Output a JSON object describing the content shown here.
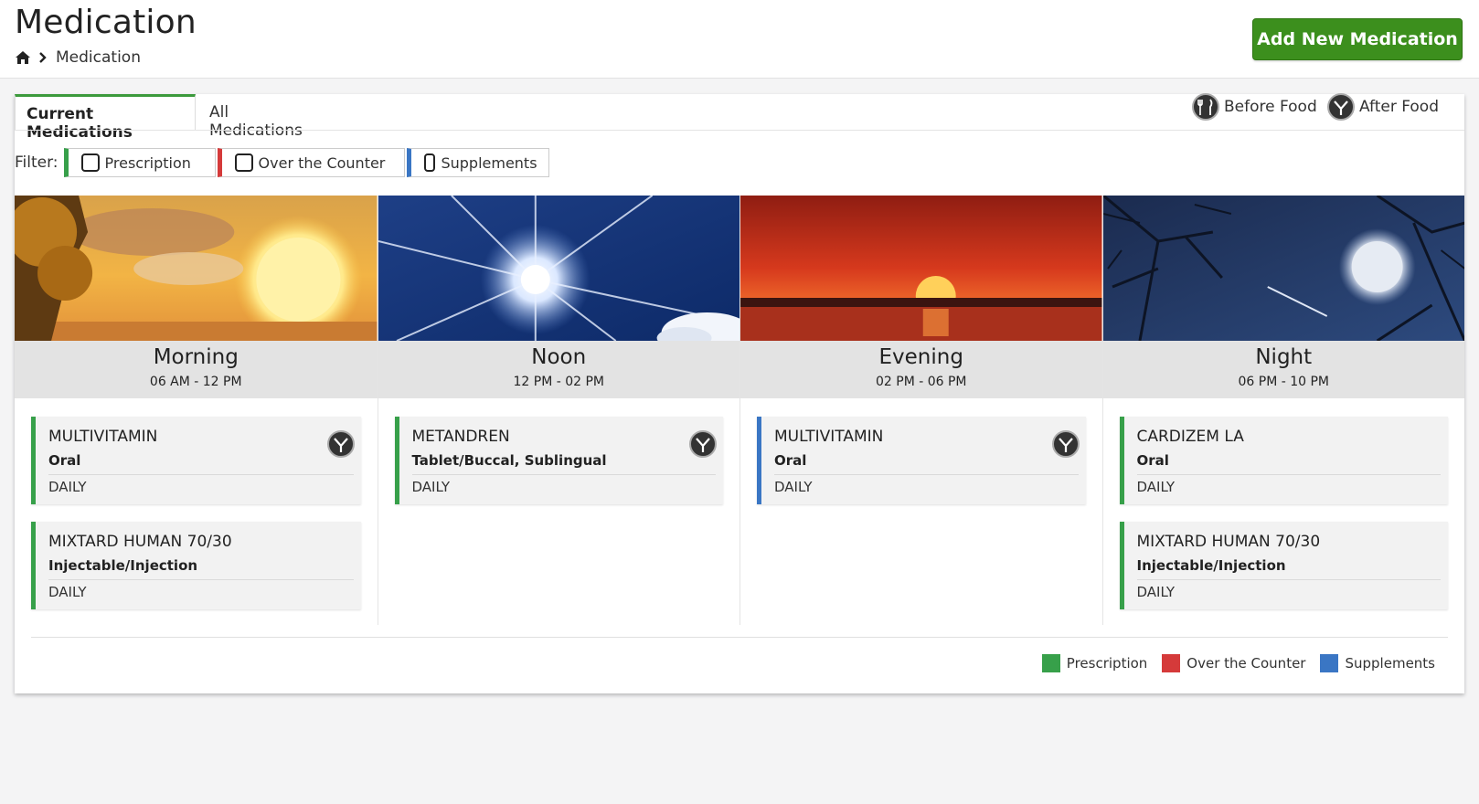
{
  "header": {
    "title": "Medication",
    "breadcrumb_current": "Medication",
    "add_button_label": "Add New Medication"
  },
  "tabs": [
    {
      "label": "Current Medications",
      "active": true
    },
    {
      "label": "All Medications",
      "active": false
    }
  ],
  "food_legend": [
    {
      "label": "Before Food",
      "icon": "before-food-icon"
    },
    {
      "label": "After Food",
      "icon": "after-food-icon"
    }
  ],
  "filter": {
    "label": "Filter:",
    "options": [
      {
        "label": "Prescription",
        "checked": false,
        "color": "#37a04a"
      },
      {
        "label": "Over the Counter",
        "checked": false,
        "color": "#d53a3a"
      },
      {
        "label": "Supplements",
        "checked": false,
        "color": "#3a76c4"
      }
    ]
  },
  "columns": [
    {
      "name": "Morning",
      "time": "06 AM - 12 PM",
      "image": "sunrise-scene",
      "meds": [
        {
          "name": "MULTIVITAMIN",
          "route": "Oral",
          "frequency": "DAILY",
          "type": "Prescription",
          "food_icon": "after-food-icon"
        },
        {
          "name": "MIXTARD HUMAN 70/30",
          "route": "Injectable/Injection",
          "frequency": "DAILY",
          "type": "Prescription",
          "food_icon": ""
        }
      ]
    },
    {
      "name": "Noon",
      "time": "12 PM - 02 PM",
      "image": "bright-sun-scene",
      "meds": [
        {
          "name": "METANDREN",
          "route": "Tablet/Buccal, Sublingual",
          "frequency": "DAILY",
          "type": "Prescription",
          "food_icon": "after-food-icon"
        }
      ]
    },
    {
      "name": "Evening",
      "time": "02 PM - 06 PM",
      "image": "sunset-scene",
      "meds": [
        {
          "name": "MULTIVITAMIN",
          "route": "Oral",
          "frequency": "DAILY",
          "type": "Supplements",
          "food_icon": "after-food-icon"
        }
      ]
    },
    {
      "name": "Night",
      "time": "06 PM - 10 PM",
      "image": "night-moon-scene",
      "meds": [
        {
          "name": "CARDIZEM LA",
          "route": "Oral",
          "frequency": "DAILY",
          "type": "Prescription",
          "food_icon": ""
        },
        {
          "name": "MIXTARD HUMAN 70/30",
          "route": "Injectable/Injection",
          "frequency": "DAILY",
          "type": "Prescription",
          "food_icon": ""
        }
      ]
    }
  ],
  "legend": [
    {
      "label": "Prescription",
      "color": "#37a04a"
    },
    {
      "label": "Over the Counter",
      "color": "#d53a3a"
    },
    {
      "label": "Supplements",
      "color": "#3a76c4"
    }
  ]
}
